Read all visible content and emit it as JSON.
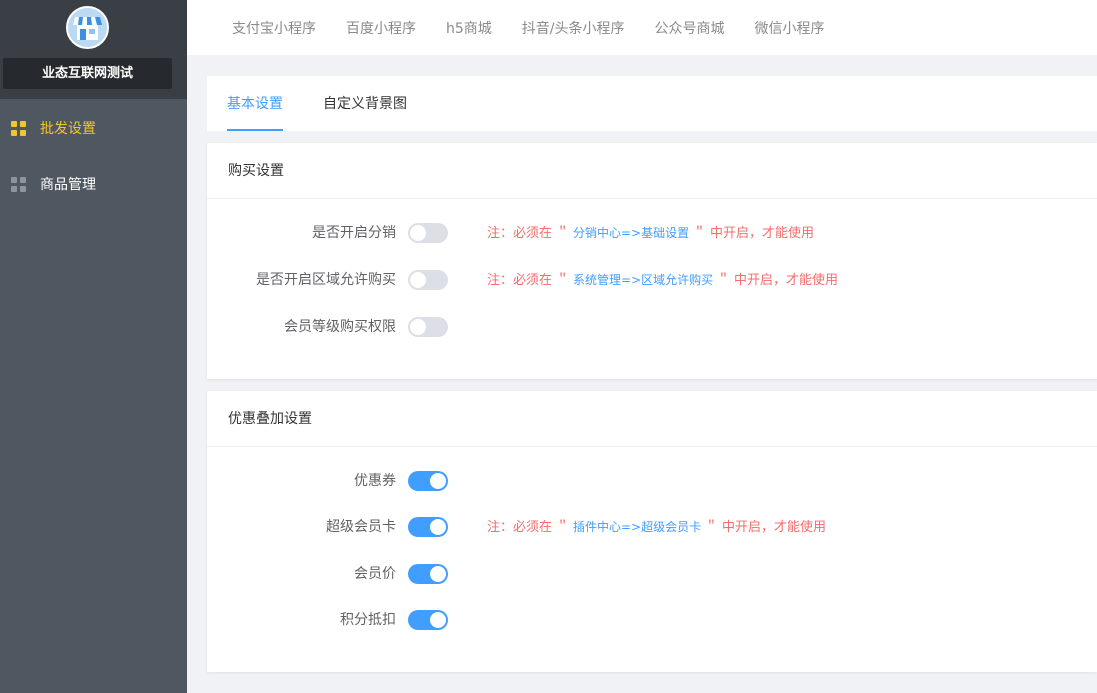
{
  "sidebar": {
    "store_name": "业态互联网测试",
    "avatar_icon": "store-icon",
    "items": [
      {
        "label": "批发设置",
        "icon": "grid-icon",
        "active": true
      },
      {
        "label": "商品管理",
        "icon": "grid-icon",
        "active": false
      }
    ]
  },
  "topbar": {
    "tabs": [
      "支付宝小程序",
      "百度小程序",
      "h5商城",
      "抖音/头条小程序",
      "公众号商城",
      "微信小程序"
    ]
  },
  "subtabs": [
    {
      "label": "基本设置",
      "active": true
    },
    {
      "label": "自定义背景图",
      "active": false
    }
  ],
  "purchase": {
    "title": "购买设置",
    "rows": [
      {
        "label": "是否开启分销",
        "on": false,
        "note_prefix": "注：必须在 ＂",
        "note_link": " 分销中心=>基础设置 ",
        "note_suffix": "＂ 中开启，才能使用"
      },
      {
        "label": "是否开启区域允许购买",
        "on": false,
        "note_prefix": "注：必须在 ＂",
        "note_link": " 系统管理=>区域允许购买 ",
        "note_suffix": "＂ 中开启，才能使用"
      },
      {
        "label": "会员等级购买权限",
        "on": false
      }
    ]
  },
  "discount": {
    "title": "优惠叠加设置",
    "rows": [
      {
        "label": "优惠券",
        "on": true
      },
      {
        "label": "超级会员卡",
        "on": true,
        "note_prefix": "注：必须在 ＂",
        "note_link": " 插件中心=>超级会员卡 ",
        "note_suffix": "＂ 中开启，才能使用"
      },
      {
        "label": "会员价",
        "on": true
      },
      {
        "label": "积分抵扣",
        "on": true
      }
    ]
  },
  "colors": {
    "accent": "#409eff",
    "warning_text": "#f56c6c",
    "active_nav": "#f5c52c",
    "sidebar_bg": "#4f5761"
  }
}
